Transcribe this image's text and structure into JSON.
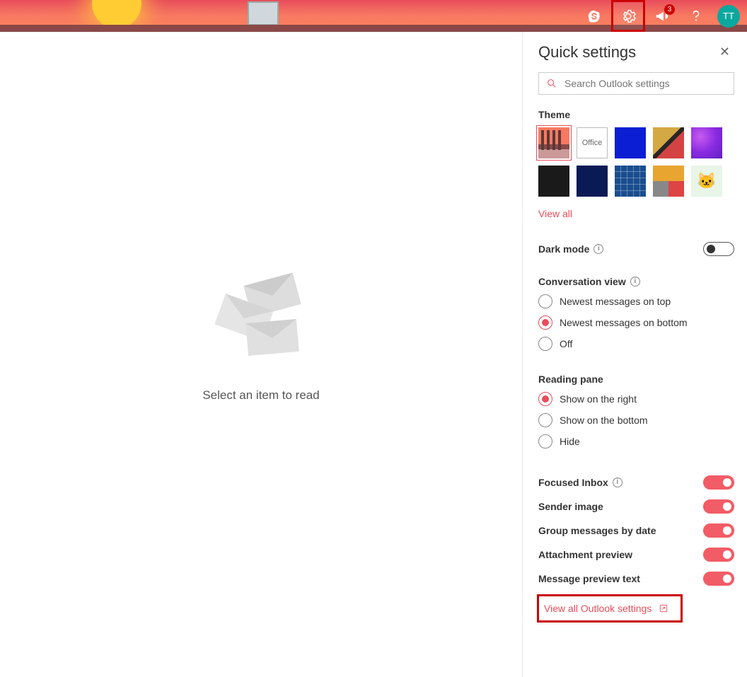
{
  "header": {
    "notification_count": "3",
    "avatar": "TT"
  },
  "reading": {
    "empty_text": "Select an item to read"
  },
  "panel": {
    "title": "Quick settings",
    "search_placeholder": "Search Outlook settings",
    "theme": {
      "label": "Theme",
      "office_label": "Office",
      "view_all": "View all"
    },
    "dark_mode": {
      "label": "Dark mode",
      "on": false
    },
    "conversation": {
      "label": "Conversation view",
      "options": {
        "top": "Newest messages on top",
        "bottom": "Newest messages on bottom",
        "off": "Off"
      },
      "selected": "bottom"
    },
    "reading_pane": {
      "label": "Reading pane",
      "options": {
        "right": "Show on the right",
        "bottom": "Show on the bottom",
        "hide": "Hide"
      },
      "selected": "right"
    },
    "toggles": {
      "focused": {
        "label": "Focused Inbox",
        "on": true
      },
      "sender": {
        "label": "Sender image",
        "on": true
      },
      "group": {
        "label": "Group messages by date",
        "on": true
      },
      "attach": {
        "label": "Attachment preview",
        "on": true
      },
      "preview": {
        "label": "Message preview text",
        "on": true
      }
    },
    "view_all_link": "View all Outlook settings"
  }
}
